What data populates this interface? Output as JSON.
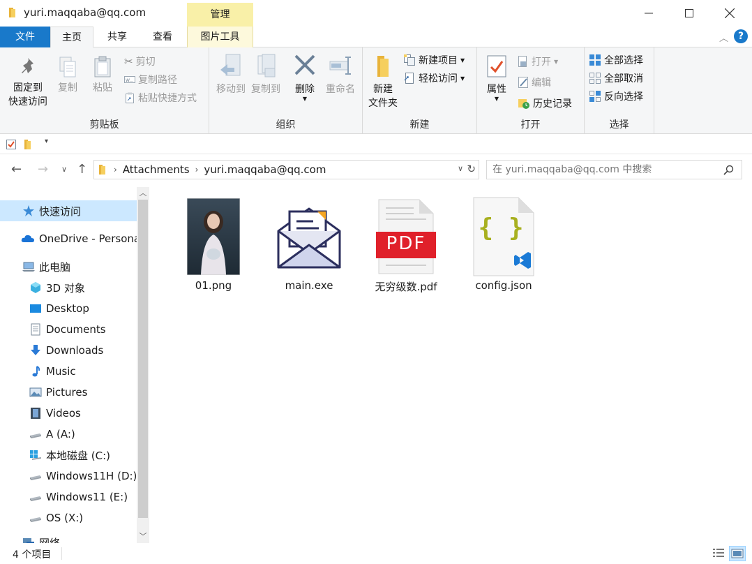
{
  "window": {
    "title": "yuri.maqqaba@qq.com",
    "manage_label": "管理",
    "minimize": "—",
    "maximize": "☐",
    "close": "✕"
  },
  "tabs": {
    "file": "文件",
    "home": "主页",
    "share": "共享",
    "view": "查看",
    "picture_tools": "图片工具"
  },
  "ribbon": {
    "clipboard": {
      "label": "剪贴板",
      "pin_line1": "固定到",
      "pin_line2": "快速访问",
      "copy": "复制",
      "paste": "粘贴",
      "cut": "剪切",
      "copy_path": "复制路径",
      "paste_shortcut": "粘贴快捷方式"
    },
    "organize": {
      "label": "组织",
      "move_to": "移动到",
      "copy_to": "复制到",
      "delete": "删除",
      "rename": "重命名"
    },
    "new": {
      "label": "新建",
      "new_folder_line1": "新建",
      "new_folder_line2": "文件夹",
      "new_item": "新建项目",
      "easy_access": "轻松访问"
    },
    "open": {
      "label": "打开",
      "properties": "属性",
      "open": "打开",
      "edit": "编辑",
      "history": "历史记录"
    },
    "select": {
      "label": "选择",
      "select_all": "全部选择",
      "select_none": "全部取消",
      "invert": "反向选择"
    }
  },
  "address": {
    "segments": [
      "Attachments",
      "yuri.maqqaba@qq.com"
    ],
    "search_placeholder": "在 yuri.maqqaba@qq.com 中搜索"
  },
  "nav": {
    "items": [
      {
        "label": "快速访问",
        "icon": "star-icon"
      },
      {
        "label": "OneDrive - Persona",
        "icon": "cloud-icon"
      },
      {
        "label": "此电脑",
        "icon": "computer-icon"
      },
      {
        "label": "3D 对象",
        "icon": "cube-icon"
      },
      {
        "label": "Desktop",
        "icon": "desktop-icon"
      },
      {
        "label": "Documents",
        "icon": "document-icon"
      },
      {
        "label": "Downloads",
        "icon": "download-icon"
      },
      {
        "label": "Music",
        "icon": "music-icon"
      },
      {
        "label": "Pictures",
        "icon": "pictures-icon"
      },
      {
        "label": "Videos",
        "icon": "video-icon"
      },
      {
        "label": "A (A:)",
        "icon": "drive-icon"
      },
      {
        "label": "本地磁盘 (C:)",
        "icon": "windows-drive-icon"
      },
      {
        "label": "Windows11H (D:)",
        "icon": "drive-icon"
      },
      {
        "label": "Windows11 (E:)",
        "icon": "drive-icon"
      },
      {
        "label": "OS (X:)",
        "icon": "drive-icon"
      },
      {
        "label": "网络",
        "icon": "network-icon"
      }
    ]
  },
  "files": [
    {
      "name": "01.png",
      "icon": "image-thumbnail"
    },
    {
      "name": "main.exe",
      "icon": "mail-icon"
    },
    {
      "name": "无穷级数.pdf",
      "icon": "pdf-icon",
      "badge": "PDF"
    },
    {
      "name": "config.json",
      "icon": "json-icon",
      "badge": "{ }"
    }
  ],
  "status": {
    "item_count": "4 个项目"
  },
  "colors": {
    "accent": "#1979ca",
    "manage_tab": "#f9f0a8",
    "selection": "#cce8ff",
    "pdf_red": "#e0202a"
  }
}
